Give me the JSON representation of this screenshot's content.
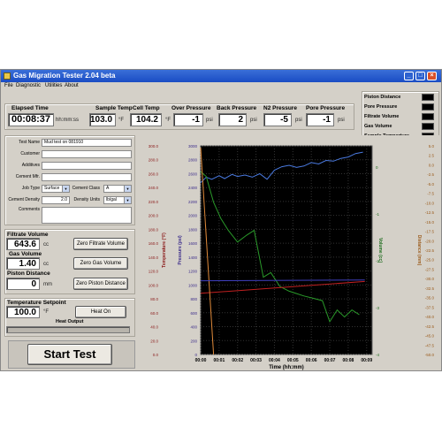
{
  "window": {
    "title": "Gas Migration Tester 2.04 beta"
  },
  "menu": [
    "File",
    "Diagnostic",
    "Utilities",
    "About"
  ],
  "readouts": [
    {
      "label": "Elapsed Time",
      "value": "00:08:37",
      "unit": "hh:mm:ss"
    },
    {
      "label": "Sample Temp",
      "value": "103.0",
      "unit": "°F"
    },
    {
      "label": "Cell Temp",
      "value": "104.2",
      "unit": "°F"
    },
    {
      "label": "Over Pressure",
      "value": "-1",
      "unit": "psi"
    },
    {
      "label": "Back Pressure",
      "value": "2",
      "unit": "psi"
    },
    {
      "label": "N2 Pressure",
      "value": "-5",
      "unit": "psi"
    },
    {
      "label": "Pore Pressure",
      "value": "-1",
      "unit": "psi"
    }
  ],
  "legend": [
    "Piston Distance",
    "Pore Pressure",
    "Filtrate Volume",
    "Gas Volume",
    "Sample Temperture"
  ],
  "form": {
    "test_name_label": "Test Name",
    "test_name": "Mud test on 081910",
    "customer_label": "Customer",
    "customer": "",
    "additives_label": "Additives",
    "additives": "",
    "cement_mfr_label": "Cement Mfr.",
    "cement_mfr": "",
    "job_type_label": "Job Type",
    "job_type": "Surface",
    "cement_class_label": "Cement Class",
    "cement_class": "A",
    "cement_density_label": "Cement Density",
    "cement_density": "2.0",
    "density_units_label": "Density Units",
    "density_units": "lb/gal",
    "comments_label": "Comments",
    "comments": ""
  },
  "volumes": {
    "filtrate_label": "Filtrate Volume",
    "filtrate": "643.6",
    "filtrate_unit": "cc",
    "gas_label": "Gas Volume",
    "gas": "1.40",
    "gas_unit": "cc",
    "piston_label": "Piston Distance",
    "piston": "0",
    "piston_unit": "mm",
    "zero_filtrate": "Zero Filtrate Volume",
    "zero_gas": "Zero Gas Volume",
    "zero_piston": "Zero Piston Distance"
  },
  "temperature": {
    "setpoint_label": "Temperature Setpoint",
    "setpoint": "100.0",
    "unit": "°F",
    "heat_button": "Heat On",
    "heat_output_label": "Heat Output"
  },
  "start_button": "Start Test",
  "chart_data": {
    "type": "line",
    "xlabel": "Time (hh:mm)",
    "x_ticks": [
      "00:00",
      "00:01",
      "00:02",
      "00:03",
      "00:04",
      "00:05",
      "00:06",
      "00:07",
      "00:08",
      "00:09"
    ],
    "xlim": [
      0,
      9.3
    ],
    "axes": [
      {
        "label": "Temperature (°F)",
        "color": "#8b1a1a",
        "ticks": [
          "0.0",
          "20.0",
          "40.0",
          "60.0",
          "80.0",
          "100.0",
          "120.0",
          "140.0",
          "160.0",
          "180.0",
          "200.0",
          "220.0",
          "240.0",
          "260.0",
          "280.0",
          "300.0"
        ]
      },
      {
        "label": "Pressure (psi)",
        "color": "#3a2a8a",
        "ticks": [
          "0",
          "200",
          "400",
          "600",
          "800",
          "1000",
          "1200",
          "1400",
          "1600",
          "1800",
          "2000",
          "2200",
          "2400",
          "2600",
          "2800",
          "3000"
        ]
      },
      {
        "label": "Volume (cc)",
        "color": "#1a6a1a",
        "ticks": [
          "-4",
          "-3",
          "-2",
          "-1",
          "0"
        ]
      },
      {
        "label": "Distance (mm)",
        "color": "#9a5a1a",
        "ticks": [
          "-50.0",
          "-47.5",
          "-45.0",
          "-42.5",
          "-40.0",
          "-37.5",
          "-35.0",
          "-32.5",
          "-30.0",
          "-27.5",
          "-25.0",
          "-22.5",
          "-20.0",
          "-17.5",
          "-15.0",
          "-12.5",
          "-10.0",
          "-7.5",
          "-5.0",
          "-2.5",
          "0.0",
          "2.5",
          "5.0"
        ]
      }
    ],
    "series": [
      {
        "name": "Pressure",
        "color": "#4a7ae0",
        "x": [
          0,
          0.3,
          0.6,
          1,
          1.3,
          1.7,
          2,
          2.4,
          2.8,
          3.2,
          3.6,
          4,
          4.4,
          4.8,
          5.2,
          5.6,
          6,
          6.4,
          6.8,
          7.2,
          7.6,
          8,
          8.4,
          8.8
        ],
        "y": [
          2470,
          2550,
          2520,
          2570,
          2530,
          2590,
          2560,
          2580,
          2550,
          2600,
          2520,
          2650,
          2700,
          2720,
          2690,
          2710,
          2760,
          2740,
          2790,
          2780,
          2820,
          2840,
          2890,
          2910
        ]
      },
      {
        "name": "Volume",
        "color": "#2a9a2a",
        "x": [
          0,
          0.3,
          0.7,
          1.1,
          1.5,
          2,
          2.5,
          2.9,
          3.4,
          3.8,
          4.3,
          4.8,
          5.2,
          5.6,
          6.1,
          6.6,
          7,
          7.4,
          7.8,
          8.2,
          8.6
        ],
        "y": [
          -0.1,
          -0.2,
          -0.75,
          -1.1,
          -1.35,
          -1.6,
          -1.45,
          -1.35,
          -2.35,
          -2.25,
          -2.55,
          -2.65,
          -2.7,
          -2.75,
          -2.8,
          -2.85,
          -3.3,
          -3.05,
          -3.2,
          -3.05,
          -3.15
        ]
      },
      {
        "name": "Temperature",
        "color": "#c02020",
        "x": [
          0,
          8.9
        ],
        "y": [
          88,
          105
        ]
      },
      {
        "name": "Piston Distance",
        "color": "#e08a3a",
        "x": [
          0,
          0.7
        ],
        "y": [
          4.5,
          -50
        ]
      },
      {
        "name": "Pore Pressure",
        "color": "#4040c0",
        "x": [
          0,
          8.9
        ],
        "y": [
          1060,
          1070
        ]
      }
    ]
  }
}
